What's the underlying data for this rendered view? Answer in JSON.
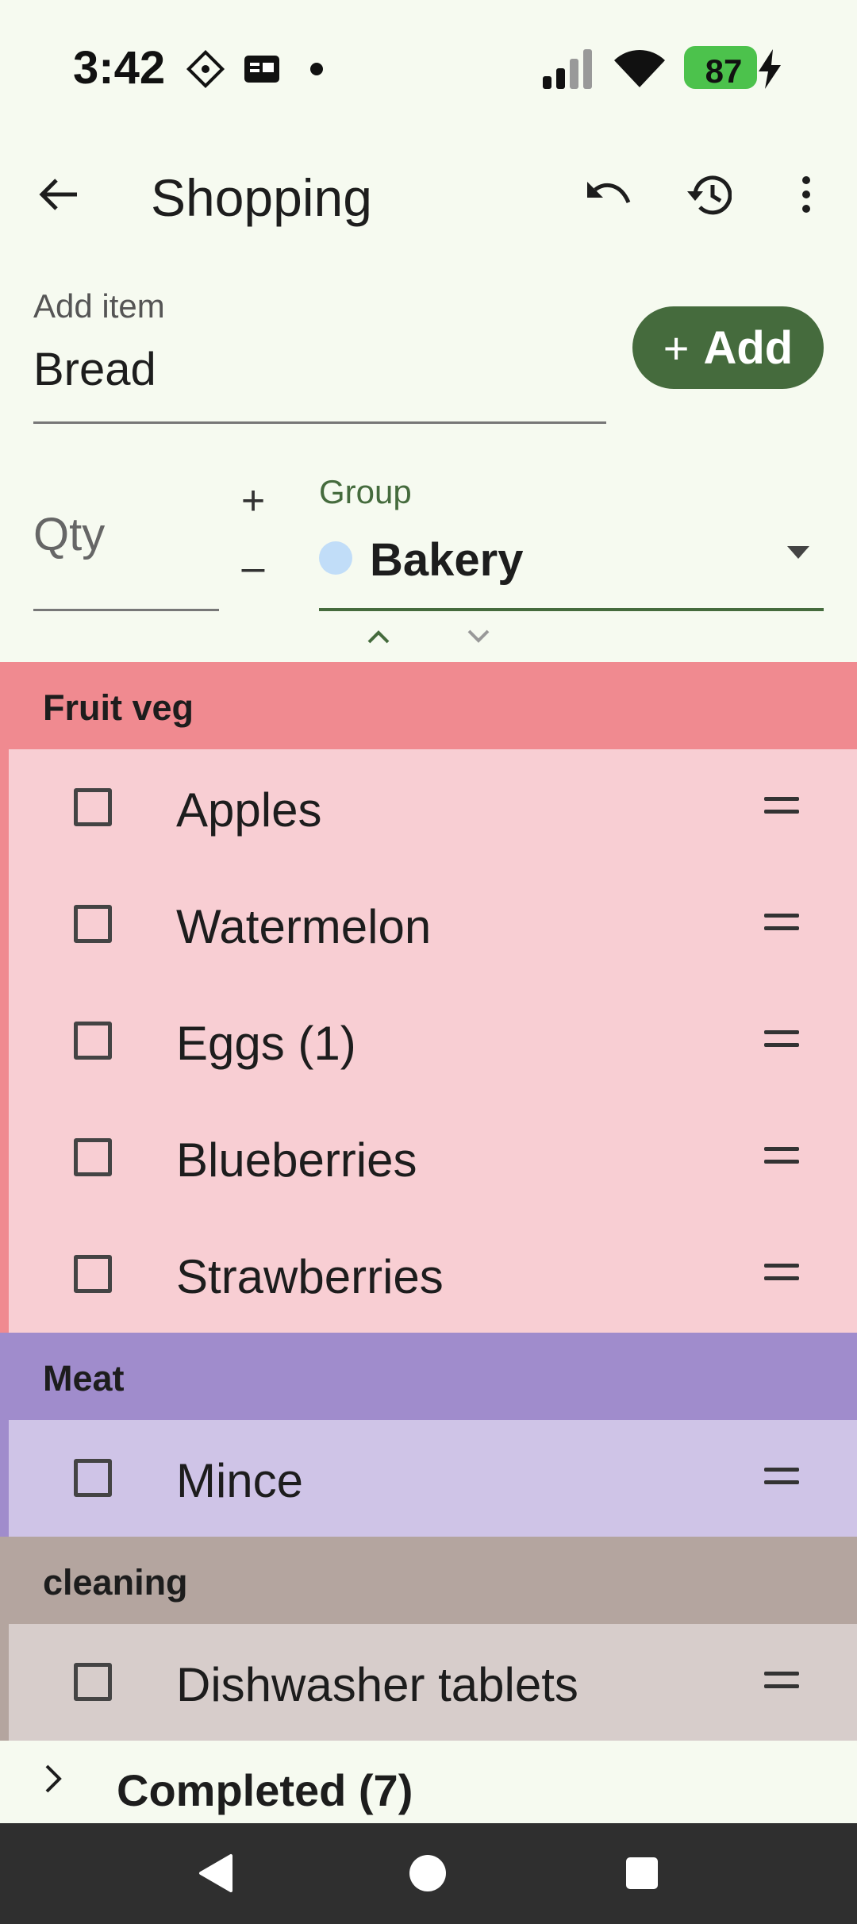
{
  "status_bar": {
    "time": "3:42",
    "battery": "87",
    "icons": [
      "sim-diamond-icon",
      "message-card-icon",
      "dot-icon",
      "signal-icon",
      "wifi-icon",
      "charging-icon"
    ]
  },
  "app_bar": {
    "title": "Shopping",
    "icons": [
      "back-arrow-icon",
      "undo-icon",
      "history-icon",
      "more-vert-icon"
    ]
  },
  "add_item": {
    "label": "Add item",
    "value": "Bread",
    "button_plus": "+",
    "button_label": "Add"
  },
  "quantity": {
    "placeholder": "Qty",
    "increment": "+",
    "decrement": "–"
  },
  "group_select": {
    "label": "Group",
    "value": "Bakery",
    "dot_color": "#c1ddf8"
  },
  "groups": [
    {
      "name": "Fruit veg",
      "header_color": "#f08a90",
      "body_color": "#f8ced3",
      "items": [
        "Apples",
        "Watermelon",
        "Eggs (1)",
        "Blueberries",
        "Strawberries"
      ]
    },
    {
      "name": "Meat",
      "header_color": "#a08ccc",
      "body_color": "#cfc4e7",
      "items": [
        "Mince"
      ]
    },
    {
      "name": "cleaning",
      "header_color": "#b4a59f",
      "body_color": "#d7cdcb",
      "items": [
        "Dishwasher tablets"
      ]
    }
  ],
  "completed": {
    "label": "Completed (7)"
  },
  "accent_color": "#456b3d"
}
